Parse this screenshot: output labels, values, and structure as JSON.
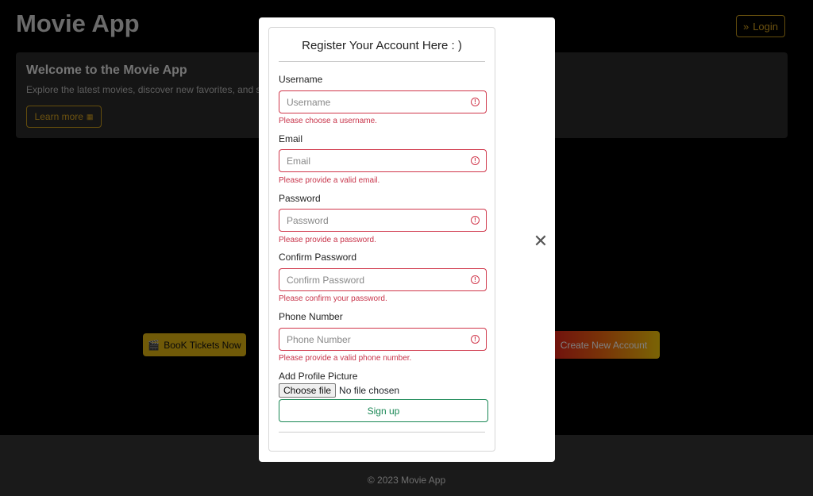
{
  "app": {
    "title": "Movie App",
    "login_label": "Login",
    "login_icon": "double-chevron-right-icon"
  },
  "welcome": {
    "heading": "Welcome to the Movie App",
    "text": "Explore the latest movies, discover new favorites, and st",
    "learn_more_label": "Learn more"
  },
  "actions": {
    "book_tickets_label": "BooK Tickets Now",
    "create_account_label": "Create New Account"
  },
  "footer": {
    "text": "© 2023 Movie App"
  },
  "modal": {
    "title": "Register Your Account Here : )",
    "close_glyph": "✕",
    "fields": {
      "username": {
        "label": "Username",
        "placeholder": "Username",
        "error": "Please choose a username."
      },
      "email": {
        "label": "Email",
        "placeholder": "Email",
        "error": "Please provide a valid email."
      },
      "password": {
        "label": "Password",
        "placeholder": "Password",
        "error": "Please provide a password."
      },
      "confirm_password": {
        "label": "Confirm Password",
        "placeholder": "Confirm Password",
        "error": "Please confirm your password."
      },
      "phone": {
        "label": "Phone Number",
        "placeholder": "Phone Number",
        "error": "Please provide a valid phone number."
      }
    },
    "profile_picture": {
      "label": "Add Profile Picture",
      "button_label": "Choose file",
      "status": "No file chosen"
    },
    "signup_label": "Sign up"
  },
  "colors": {
    "accent_gold": "#d9a520",
    "error_red": "#d0374b",
    "success_green": "#198754",
    "book_yellow": "#e0b411"
  }
}
